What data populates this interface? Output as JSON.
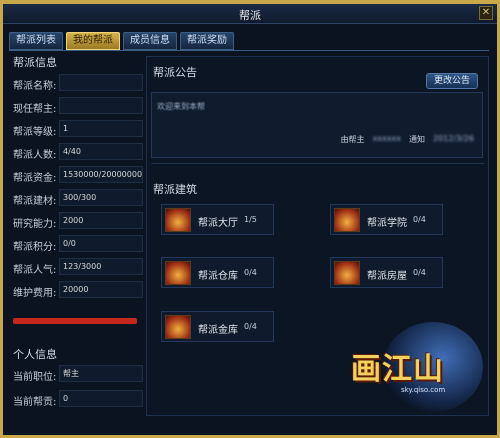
{
  "window": {
    "title": "帮派"
  },
  "tabs": [
    "帮派列表",
    "我的帮派",
    "成员信息",
    "帮派奖励"
  ],
  "left": {
    "section_title": "帮派信息",
    "rows": [
      {
        "label": "帮派名称:",
        "value": ""
      },
      {
        "label": "现任帮主:",
        "value": ""
      },
      {
        "label": "帮派等级:",
        "value": "1"
      },
      {
        "label": "帮派人数:",
        "value": "4/40"
      },
      {
        "label": "帮派资金:",
        "value": "1530000/20000000"
      },
      {
        "label": "帮派建材:",
        "value": "300/300"
      },
      {
        "label": "研究能力:",
        "value": "2000"
      },
      {
        "label": "帮派积分:",
        "value": "0/0"
      },
      {
        "label": "帮派人气:",
        "value": "123/3000"
      },
      {
        "label": "维护费用:",
        "value": "20000"
      }
    ],
    "personal_title": "个人信息",
    "personal_rows": [
      {
        "label": "当前职位:",
        "value": "帮主"
      },
      {
        "label": "当前帮贡:",
        "value": "0"
      }
    ]
  },
  "right": {
    "notice_title": "帮派公告",
    "change_button": "更改公告",
    "notice_text": "欢迎来到本帮",
    "notice_footer": {
      "prefix": "由帮主",
      "name": "xxxxxx",
      "action": "通知",
      "time": "2012/3/26"
    },
    "build_title": "帮派建筑",
    "buildings": [
      {
        "name": "帮派大厅",
        "level": "1/5"
      },
      {
        "name": "帮派学院",
        "level": "0/4"
      },
      {
        "name": "帮派仓库",
        "level": "0/4"
      },
      {
        "name": "帮派房屋",
        "level": "0/4"
      },
      {
        "name": "帮派金库",
        "level": "0/4"
      }
    ]
  },
  "logo": {
    "word": "画江山",
    "url": "sky.qiso.com"
  }
}
